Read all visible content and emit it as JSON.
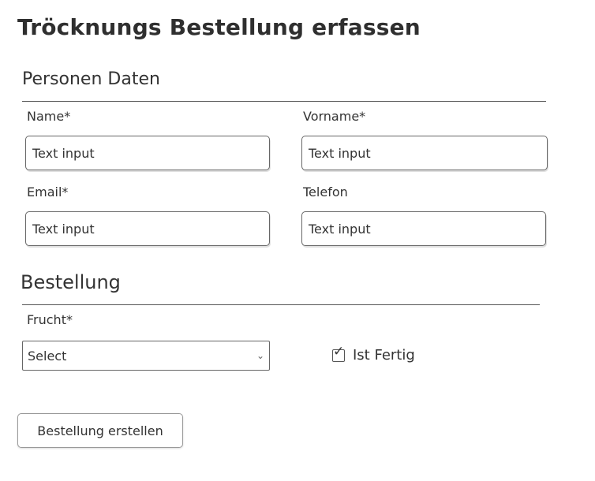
{
  "page": {
    "title": "Tröcknungs Bestellung erfassen"
  },
  "personal": {
    "section_title": "Personen Daten",
    "name_label": "Name*",
    "name_value": "Text input",
    "vorname_label": "Vorname*",
    "vorname_value": "Text input",
    "email_label": "Email*",
    "email_value": "Text input",
    "telefon_label": "Telefon",
    "telefon_value": "Text input"
  },
  "order": {
    "section_title": "Bestellung",
    "frucht_label": "Frucht*",
    "frucht_selected": "Select",
    "select_chevron": "⌄",
    "fertig_checked": true,
    "fertig_check_glyph": "✓",
    "fertig_label": "Ist Fertig",
    "submit_label": "Bestellung erstellen"
  }
}
